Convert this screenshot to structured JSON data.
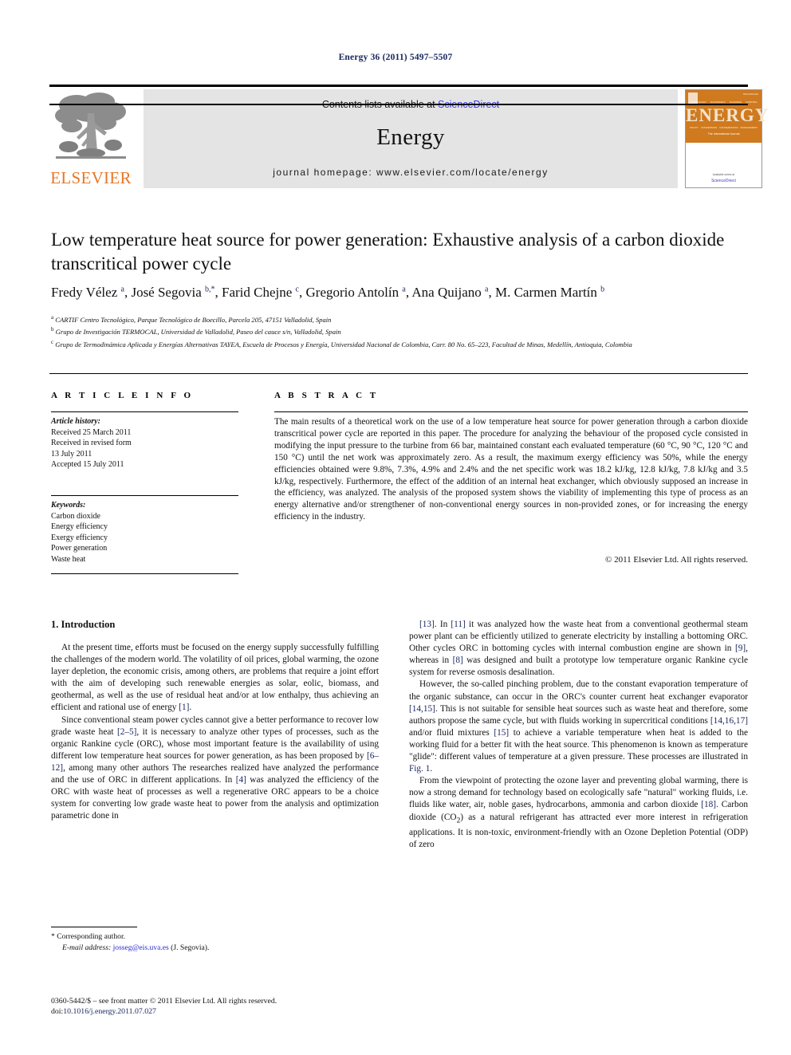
{
  "running_head": "Energy 36 (2011) 5497–5507",
  "masthead": {
    "contents_prefix": "Contents lists available at ",
    "sciencedirect": "ScienceDirect",
    "journal_title": "Energy",
    "homepage": "journal homepage: www.elsevier.com/locate/energy",
    "publisher_wordmark": "ELSEVIER",
    "accent_orange": "#e77726",
    "link_blue": "#3b3be0",
    "banner_bg": "#e4e4e4"
  },
  "cover": {
    "title": "ENERGY",
    "subtitle": "The International Journal",
    "bottom_note": "Available online at",
    "sciencedirect": "ScienceDirect",
    "url": "www.sciencedirect.com",
    "band_color": "#cf7a1f",
    "strip_top": [
      "TECHNOLOGY",
      "ECONOMICS",
      "PLANNING",
      "CONTROL"
    ],
    "strip_bottom": [
      "POLICY",
      "CONVERSION",
      "CONSERVATION",
      "MANAGEMENT"
    ]
  },
  "article": {
    "title": "Low temperature heat source for power generation: Exhaustive analysis of a carbon dioxide transcritical power cycle",
    "authors_html": "Fredy Vélez <sup>a</sup>, José Segovia <sup>b,</sup><sup>*</sup>, Farid Chejne <sup>c</sup>, Gregorio Antolín <sup>a</sup>, Ana Quijano <sup>a</sup>, M. Carmen Martín <sup>b</sup>",
    "affiliations": [
      "CARTIF Centro Tecnológico, Parque Tecnológico de Boecillo, Parcela 205, 47151 Valladolid, Spain",
      "Grupo de Investigación TERMOCAL, Universidad de Valladolid, Paseo del cauce s/n, Valladolid, Spain",
      "Grupo de Termodinámica Aplicada y Energías Alternativas TAYEA, Escuela de Procesos y Energía, Universidad Nacional de Colombia, Carr. 80 No. 65–223, Facultad de Minas, Medellín, Antioquia, Colombia"
    ],
    "affiliation_marks": [
      "a",
      "b",
      "c"
    ]
  },
  "article_info": {
    "heading": "A R T I C L E   I N F O",
    "history_label": "Article history:",
    "history_lines": [
      "Received 25 March 2011",
      "Received in revised form",
      "13 July 2011",
      "Accepted 15 July 2011"
    ],
    "keywords_label": "Keywords:",
    "keywords": [
      "Carbon dioxide",
      "Energy efficiency",
      "Exergy efficiency",
      "Power generation",
      "Waste heat"
    ]
  },
  "abstract": {
    "heading": "A B S T R A C T",
    "text": "The main results of a theoretical work on the use of a low temperature heat source for power generation through a carbon dioxide transcritical power cycle are reported in this paper. The procedure for analyzing the behaviour of the proposed cycle consisted in modifying the input pressure to the turbine from 66 bar, maintained constant each evaluated temperature (60 °C, 90 °C, 120 °C and 150 °C) until the net work was approximately zero. As a result, the maximum exergy efficiency was 50%, while the energy efficiencies obtained were 9.8%, 7.3%, 4.9% and 2.4% and the net specific work was 18.2 kJ/kg, 12.8 kJ/kg, 7.8 kJ/kg and 3.5 kJ/kg, respectively. Furthermore, the effect of the addition of an internal heat exchanger, which obviously supposed an increase in the efficiency, was analyzed. The analysis of the proposed system shows the viability of implementing this type of process as an energy alternative and/or strengthener of non-conventional energy sources in non-provided zones, or for increasing the energy efficiency in the industry.",
    "copyright": "© 2011 Elsevier Ltd. All rights reserved."
  },
  "body": {
    "section_number_title": "1. Introduction",
    "left_paragraphs": [
      "At the present time, efforts must be focused on the energy supply successfully fulfilling the challenges of the modern world. The volatility of oil prices, global warming, the ozone layer depletion, the economic crisis, among others, are problems that require a joint effort with the aim of developing such renewable energies as solar, eolic, biomass, and geothermal, as well as the use of residual heat and/or at low enthalpy, thus achieving an efficient and rational use of energy [1].",
      "Since conventional steam power cycles cannot give a better performance to recover low grade waste heat [2–5], it is necessary to analyze other types of processes, such as the organic Rankine cycle (ORC), whose most important feature is the availability of using different low temperature heat sources for power generation, as has been proposed by [6–12], among many other authors The researches realized have analyzed the performance and the use of ORC in different applications. In [4] was analyzed the efficiency of the ORC with waste heat of processes as well a regenerative ORC appears to be a choice system for converting low grade waste heat to power from the analysis and optimization parametric done in"
    ],
    "right_paragraphs": [
      "[13]. In [11] it was analyzed how the waste heat from a conventional geothermal steam power plant can be efficiently utilized to generate electricity by installing a bottoming ORC. Other cycles ORC in bottoming cycles with internal combustion engine are shown in [9], whereas in [8] was designed and built a prototype low temperature organic Rankine cycle system for reverse osmosis desalination.",
      "However, the so-called pinching problem, due to the constant evaporation temperature of the organic substance, can occur in the ORC's counter current heat exchanger evaporator [14,15]. This is not suitable for sensible heat sources such as waste heat and therefore, some authors propose the same cycle, but with fluids working in supercritical conditions [14,16,17] and/or fluid mixtures [15] to achieve a variable temperature when heat is added to the working fluid for a better fit with the heat source. This phenomenon is known as temperature \"glide\": different values of temperature at a given pressure. These processes are illustrated in Fig. 1.",
      "From the viewpoint of protecting the ozone layer and preventing global warming, there is now a strong demand for technology based on ecologically safe \"natural\" working fluids, i.e. fluids like water, air, noble gases, hydrocarbons, ammonia and carbon dioxide [18]. Carbon dioxide (CO2) as a natural refrigerant has attracted ever more interest in refrigeration applications. It is non-toxic, environment-friendly with an Ozone Depletion Potential (ODP) of zero"
    ]
  },
  "footer": {
    "corresponding_marker": "*",
    "corresponding_label": "Corresponding author.",
    "email_label": "E-mail address:",
    "email": "josseg@eis.uva.es",
    "email_owner": "(J. Segovia).",
    "issn_line": "0360-5442/$ – see front matter © 2011 Elsevier Ltd. All rights reserved.",
    "doi_label": "doi:",
    "doi": "10.1016/j.energy.2011.07.027"
  }
}
